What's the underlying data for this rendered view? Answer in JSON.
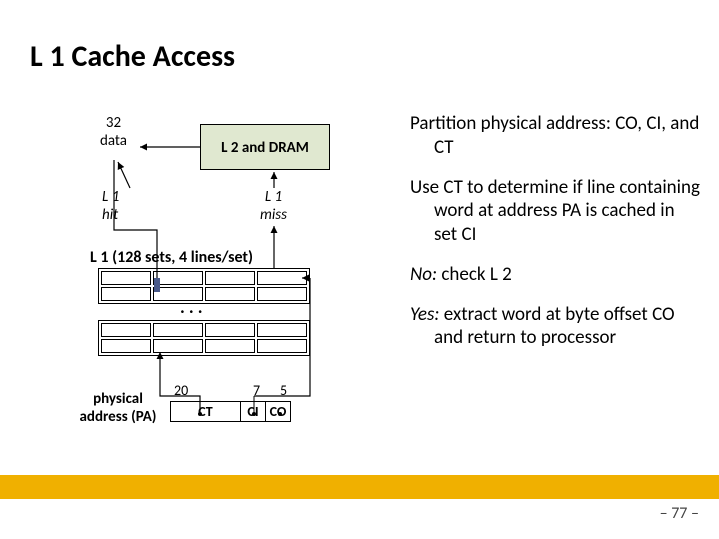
{
  "title": "L 1 Cache Access",
  "diagram": {
    "data32_top": "32",
    "data32_bottom": "data",
    "dram_label": "L 2 and DRAM",
    "l1hit_top": "L 1",
    "l1hit_bottom": "hit",
    "l1miss_top": "L 1",
    "l1miss_bottom": "miss",
    "l1cache_label": "L 1 (128 sets, 4 lines/set)",
    "dots": ". . .",
    "pa_label_top": "physical",
    "pa_label_bottom": "address (PA)",
    "bits": {
      "ct": "20",
      "ci": "7",
      "co": "5"
    },
    "fields": {
      "ct": "CT",
      "ci": "CI",
      "co": "CO"
    }
  },
  "bullets": {
    "b1": "Partition physical address: CO, CI, and CT",
    "b2": "Use CT to determine if  line containing word at address PA is cached in set CI",
    "b3_prefix": "No:",
    "b3_rest": " check L 2",
    "b4_prefix": "Yes:",
    "b4_rest": " extract word at byte offset CO and return to processor"
  },
  "pagenum": "– 77 –"
}
